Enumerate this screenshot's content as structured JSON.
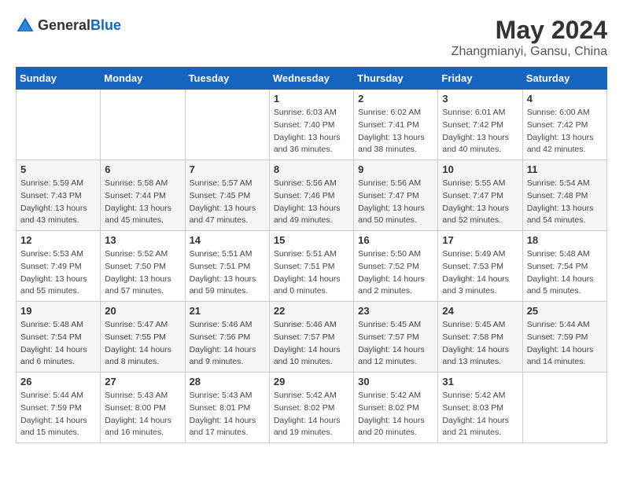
{
  "header": {
    "logo_general": "General",
    "logo_blue": "Blue",
    "month_year": "May 2024",
    "location": "Zhangmianyi, Gansu, China"
  },
  "days_of_week": [
    "Sunday",
    "Monday",
    "Tuesday",
    "Wednesday",
    "Thursday",
    "Friday",
    "Saturday"
  ],
  "weeks": [
    [
      {
        "day": "",
        "info": ""
      },
      {
        "day": "",
        "info": ""
      },
      {
        "day": "",
        "info": ""
      },
      {
        "day": "1",
        "info": "Sunrise: 6:03 AM\nSunset: 7:40 PM\nDaylight: 13 hours\nand 36 minutes."
      },
      {
        "day": "2",
        "info": "Sunrise: 6:02 AM\nSunset: 7:41 PM\nDaylight: 13 hours\nand 38 minutes."
      },
      {
        "day": "3",
        "info": "Sunrise: 6:01 AM\nSunset: 7:42 PM\nDaylight: 13 hours\nand 40 minutes."
      },
      {
        "day": "4",
        "info": "Sunrise: 6:00 AM\nSunset: 7:42 PM\nDaylight: 13 hours\nand 42 minutes."
      }
    ],
    [
      {
        "day": "5",
        "info": "Sunrise: 5:59 AM\nSunset: 7:43 PM\nDaylight: 13 hours\nand 43 minutes."
      },
      {
        "day": "6",
        "info": "Sunrise: 5:58 AM\nSunset: 7:44 PM\nDaylight: 13 hours\nand 45 minutes."
      },
      {
        "day": "7",
        "info": "Sunrise: 5:57 AM\nSunset: 7:45 PM\nDaylight: 13 hours\nand 47 minutes."
      },
      {
        "day": "8",
        "info": "Sunrise: 5:56 AM\nSunset: 7:46 PM\nDaylight: 13 hours\nand 49 minutes."
      },
      {
        "day": "9",
        "info": "Sunrise: 5:56 AM\nSunset: 7:47 PM\nDaylight: 13 hours\nand 50 minutes."
      },
      {
        "day": "10",
        "info": "Sunrise: 5:55 AM\nSunset: 7:47 PM\nDaylight: 13 hours\nand 52 minutes."
      },
      {
        "day": "11",
        "info": "Sunrise: 5:54 AM\nSunset: 7:48 PM\nDaylight: 13 hours\nand 54 minutes."
      }
    ],
    [
      {
        "day": "12",
        "info": "Sunrise: 5:53 AM\nSunset: 7:49 PM\nDaylight: 13 hours\nand 55 minutes."
      },
      {
        "day": "13",
        "info": "Sunrise: 5:52 AM\nSunset: 7:50 PM\nDaylight: 13 hours\nand 57 minutes."
      },
      {
        "day": "14",
        "info": "Sunrise: 5:51 AM\nSunset: 7:51 PM\nDaylight: 13 hours\nand 59 minutes."
      },
      {
        "day": "15",
        "info": "Sunrise: 5:51 AM\nSunset: 7:51 PM\nDaylight: 14 hours\nand 0 minutes."
      },
      {
        "day": "16",
        "info": "Sunrise: 5:50 AM\nSunset: 7:52 PM\nDaylight: 14 hours\nand 2 minutes."
      },
      {
        "day": "17",
        "info": "Sunrise: 5:49 AM\nSunset: 7:53 PM\nDaylight: 14 hours\nand 3 minutes."
      },
      {
        "day": "18",
        "info": "Sunrise: 5:48 AM\nSunset: 7:54 PM\nDaylight: 14 hours\nand 5 minutes."
      }
    ],
    [
      {
        "day": "19",
        "info": "Sunrise: 5:48 AM\nSunset: 7:54 PM\nDaylight: 14 hours\nand 6 minutes."
      },
      {
        "day": "20",
        "info": "Sunrise: 5:47 AM\nSunset: 7:55 PM\nDaylight: 14 hours\nand 8 minutes."
      },
      {
        "day": "21",
        "info": "Sunrise: 5:46 AM\nSunset: 7:56 PM\nDaylight: 14 hours\nand 9 minutes."
      },
      {
        "day": "22",
        "info": "Sunrise: 5:46 AM\nSunset: 7:57 PM\nDaylight: 14 hours\nand 10 minutes."
      },
      {
        "day": "23",
        "info": "Sunrise: 5:45 AM\nSunset: 7:57 PM\nDaylight: 14 hours\nand 12 minutes."
      },
      {
        "day": "24",
        "info": "Sunrise: 5:45 AM\nSunset: 7:58 PM\nDaylight: 14 hours\nand 13 minutes."
      },
      {
        "day": "25",
        "info": "Sunrise: 5:44 AM\nSunset: 7:59 PM\nDaylight: 14 hours\nand 14 minutes."
      }
    ],
    [
      {
        "day": "26",
        "info": "Sunrise: 5:44 AM\nSunset: 7:59 PM\nDaylight: 14 hours\nand 15 minutes."
      },
      {
        "day": "27",
        "info": "Sunrise: 5:43 AM\nSunset: 8:00 PM\nDaylight: 14 hours\nand 16 minutes."
      },
      {
        "day": "28",
        "info": "Sunrise: 5:43 AM\nSunset: 8:01 PM\nDaylight: 14 hours\nand 17 minutes."
      },
      {
        "day": "29",
        "info": "Sunrise: 5:42 AM\nSunset: 8:02 PM\nDaylight: 14 hours\nand 19 minutes."
      },
      {
        "day": "30",
        "info": "Sunrise: 5:42 AM\nSunset: 8:02 PM\nDaylight: 14 hours\nand 20 minutes."
      },
      {
        "day": "31",
        "info": "Sunrise: 5:42 AM\nSunset: 8:03 PM\nDaylight: 14 hours\nand 21 minutes."
      },
      {
        "day": "",
        "info": ""
      }
    ]
  ]
}
